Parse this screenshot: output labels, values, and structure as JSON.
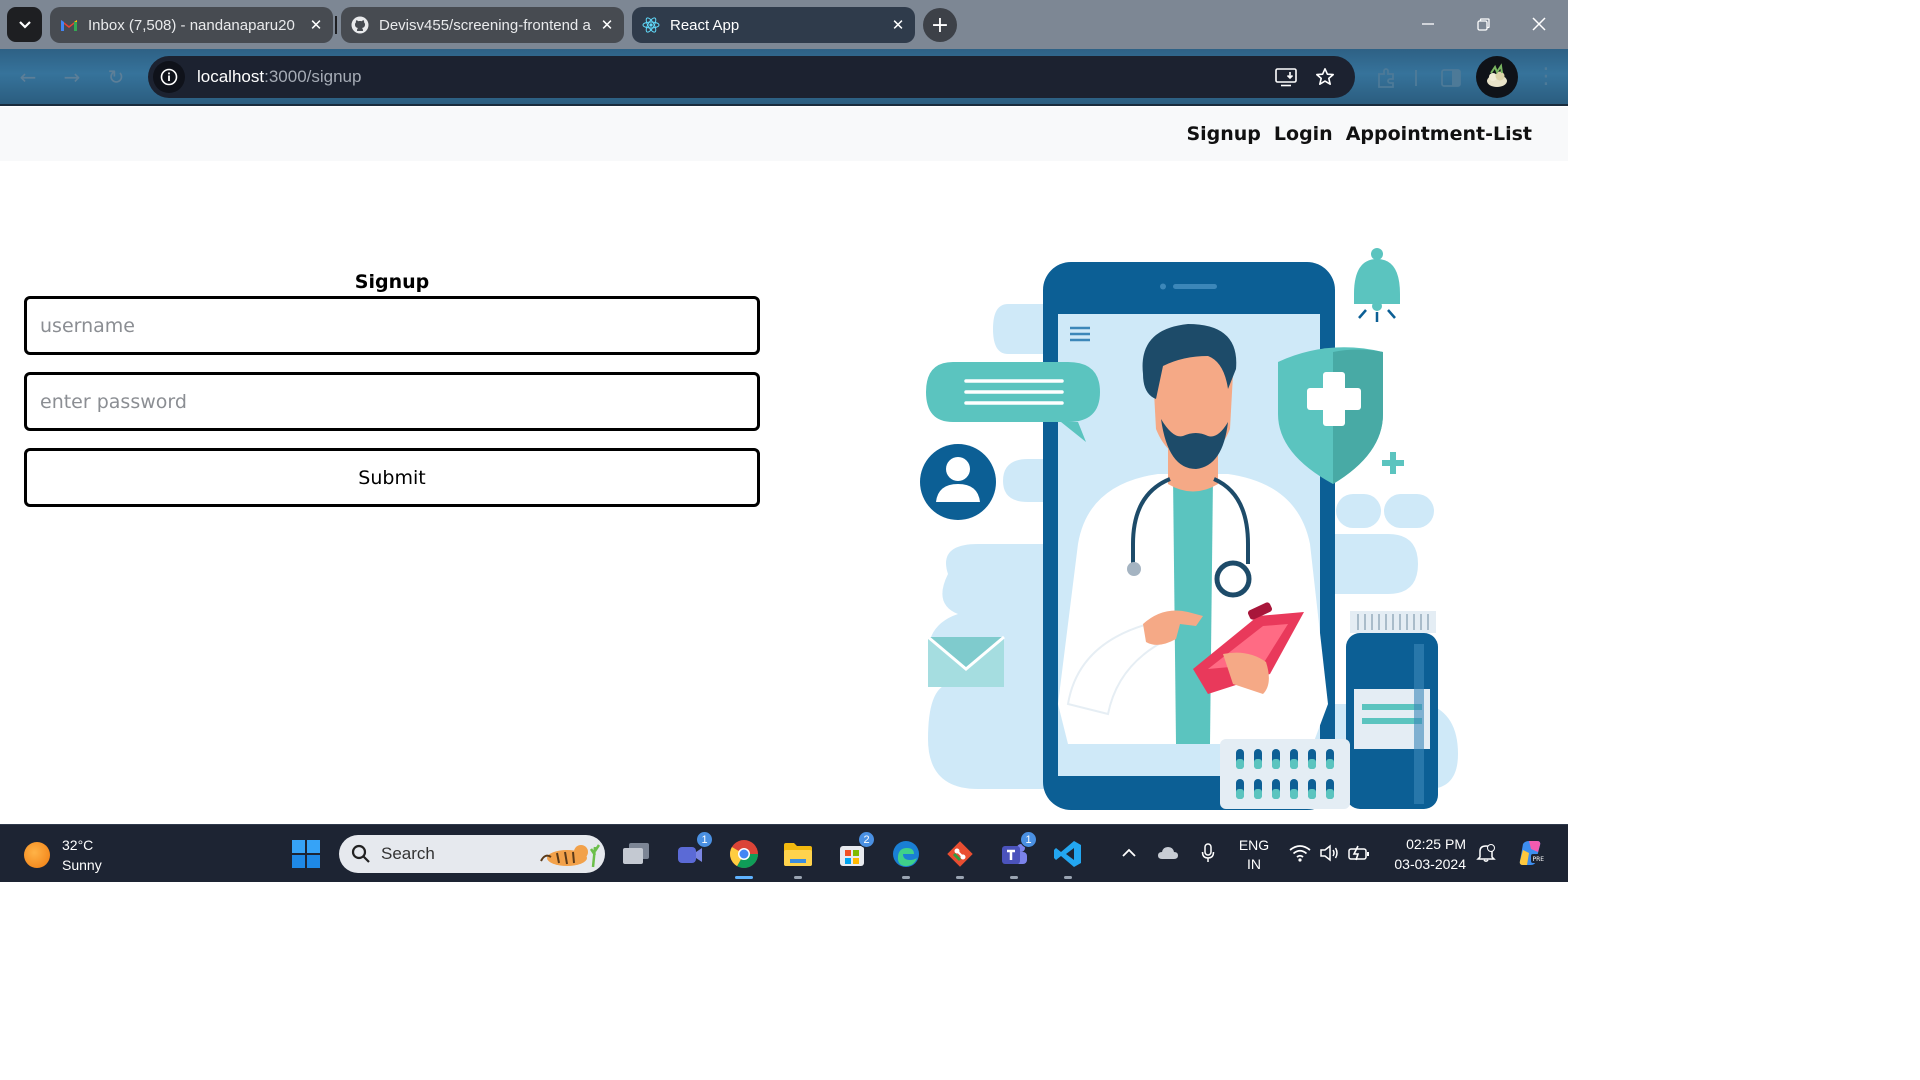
{
  "browser": {
    "tabs": [
      {
        "title": "Inbox (7,508) - nandanaparu20",
        "icon": "gmail-icon",
        "active": false
      },
      {
        "title": "Devisv455/screening-frontend a",
        "icon": "github-icon",
        "active": false
      },
      {
        "title": "React App",
        "icon": "react-icon",
        "active": true
      }
    ],
    "address": {
      "host": "localhost",
      "rest": ":3000/signup"
    }
  },
  "page": {
    "nav": {
      "signup": "Signup",
      "login": "Login",
      "appointments": "Appointment-List"
    },
    "form": {
      "title": "Signup",
      "username_placeholder": "username",
      "password_placeholder": "enter password",
      "submit_label": "Submit"
    }
  },
  "taskbar": {
    "weather": {
      "temp": "32°C",
      "condition": "Sunny"
    },
    "search_label": "Search",
    "badges": {
      "meet": "1",
      "store": "2",
      "teams": "1"
    },
    "language": {
      "line1": "ENG",
      "line2": "IN"
    },
    "clock": {
      "time": "02:25 PM",
      "date": "03-03-2024"
    }
  },
  "colors": {
    "illustration_dark_blue": "#0c5f95",
    "illustration_teal": "#5bc4bf",
    "illustration_light_blue": "#cfe9f8",
    "clipboard_red": "#e9395b"
  }
}
